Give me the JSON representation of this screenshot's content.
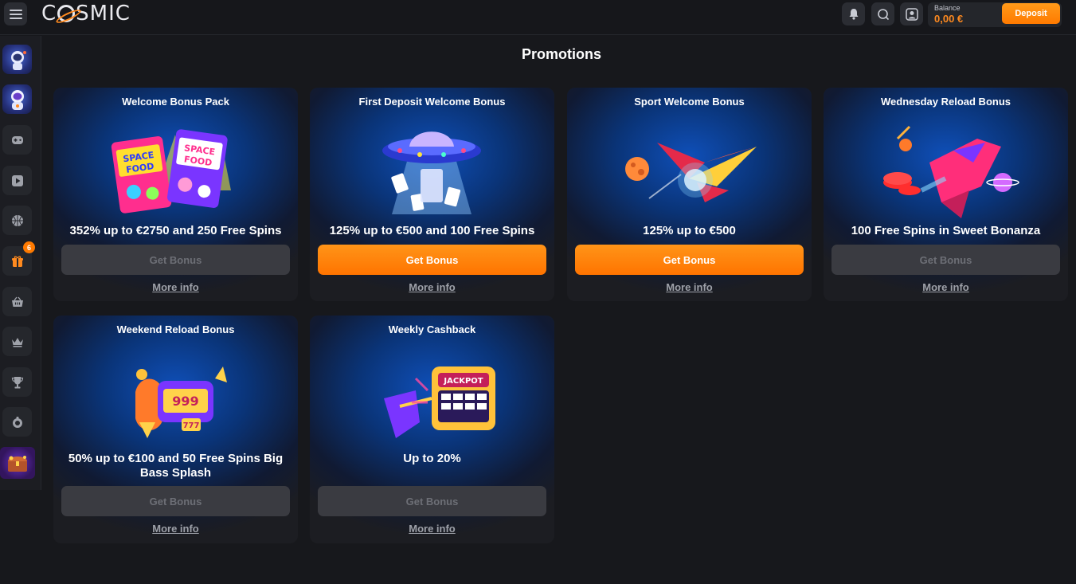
{
  "header": {
    "logo_text": [
      "C",
      "SMIC"
    ],
    "balance_label": "Balance",
    "balance_value": "0,00 €",
    "deposit_label": "Deposit",
    "icons": [
      "menu-icon",
      "bell-icon",
      "search-icon",
      "user-icon"
    ]
  },
  "sidebar": {
    "items": [
      {
        "name": "astronaut-game-thumbnail",
        "icon": "astronaut-thumb"
      },
      {
        "name": "astronaut-mascot-thumbnail",
        "icon": "astronaut-thumb"
      },
      {
        "name": "games-icon",
        "icon": "gamepad"
      },
      {
        "name": "live-casino-icon",
        "icon": "play"
      },
      {
        "name": "sports-icon",
        "icon": "basketball"
      },
      {
        "name": "promotions-icon",
        "icon": "gift",
        "badge": "6"
      },
      {
        "name": "shop-icon",
        "icon": "basket"
      },
      {
        "name": "vip-icon",
        "icon": "crown"
      },
      {
        "name": "tournaments-icon",
        "icon": "trophy"
      },
      {
        "name": "wheel-icon",
        "icon": "coin"
      },
      {
        "name": "treasure-chest-thumbnail",
        "icon": "chest-thumb"
      }
    ]
  },
  "main": {
    "title": "Promotions",
    "cards": [
      {
        "title": "Welcome Bonus Pack",
        "offer": "352% up to €2750 and 250 Free Spins",
        "button": "Get Bonus",
        "button_active": false,
        "more": "More info",
        "art": "space-food-bags"
      },
      {
        "title": "First Deposit Welcome Bonus",
        "offer": "125% up to €500 and 100 Free Spins",
        "button": "Get Bonus",
        "button_active": true,
        "more": "More info",
        "art": "ufo-cards"
      },
      {
        "title": "Sport Welcome Bonus",
        "offer": "125% up to €500",
        "button": "Get Bonus",
        "button_active": true,
        "more": "More info",
        "art": "rocket-planet"
      },
      {
        "title": "Wednesday Reload Bonus",
        "offer": "100 Free Spins in Sweet Bonanza",
        "button": "Get Bonus",
        "button_active": false,
        "more": "More info",
        "art": "spaceship-chips"
      },
      {
        "title": "Weekend Reload Bonus",
        "offer": "50% up to €100 and 50 Free Spins Big Bass Splash",
        "button": "Get Bonus",
        "button_active": false,
        "more": "More info",
        "art": "slot-rocket"
      },
      {
        "title": "Weekly Cashback",
        "offer": "Up to 20%",
        "button": "Get Bonus",
        "button_active": false,
        "more": "More info",
        "art": "jackpot-blaster"
      }
    ]
  },
  "colors": {
    "background": "#17181c",
    "accent": "#ff8a1f",
    "button_active": "#ff7a00",
    "button_inactive": "#3a3b41",
    "card_glow": "#0f4fb8"
  }
}
